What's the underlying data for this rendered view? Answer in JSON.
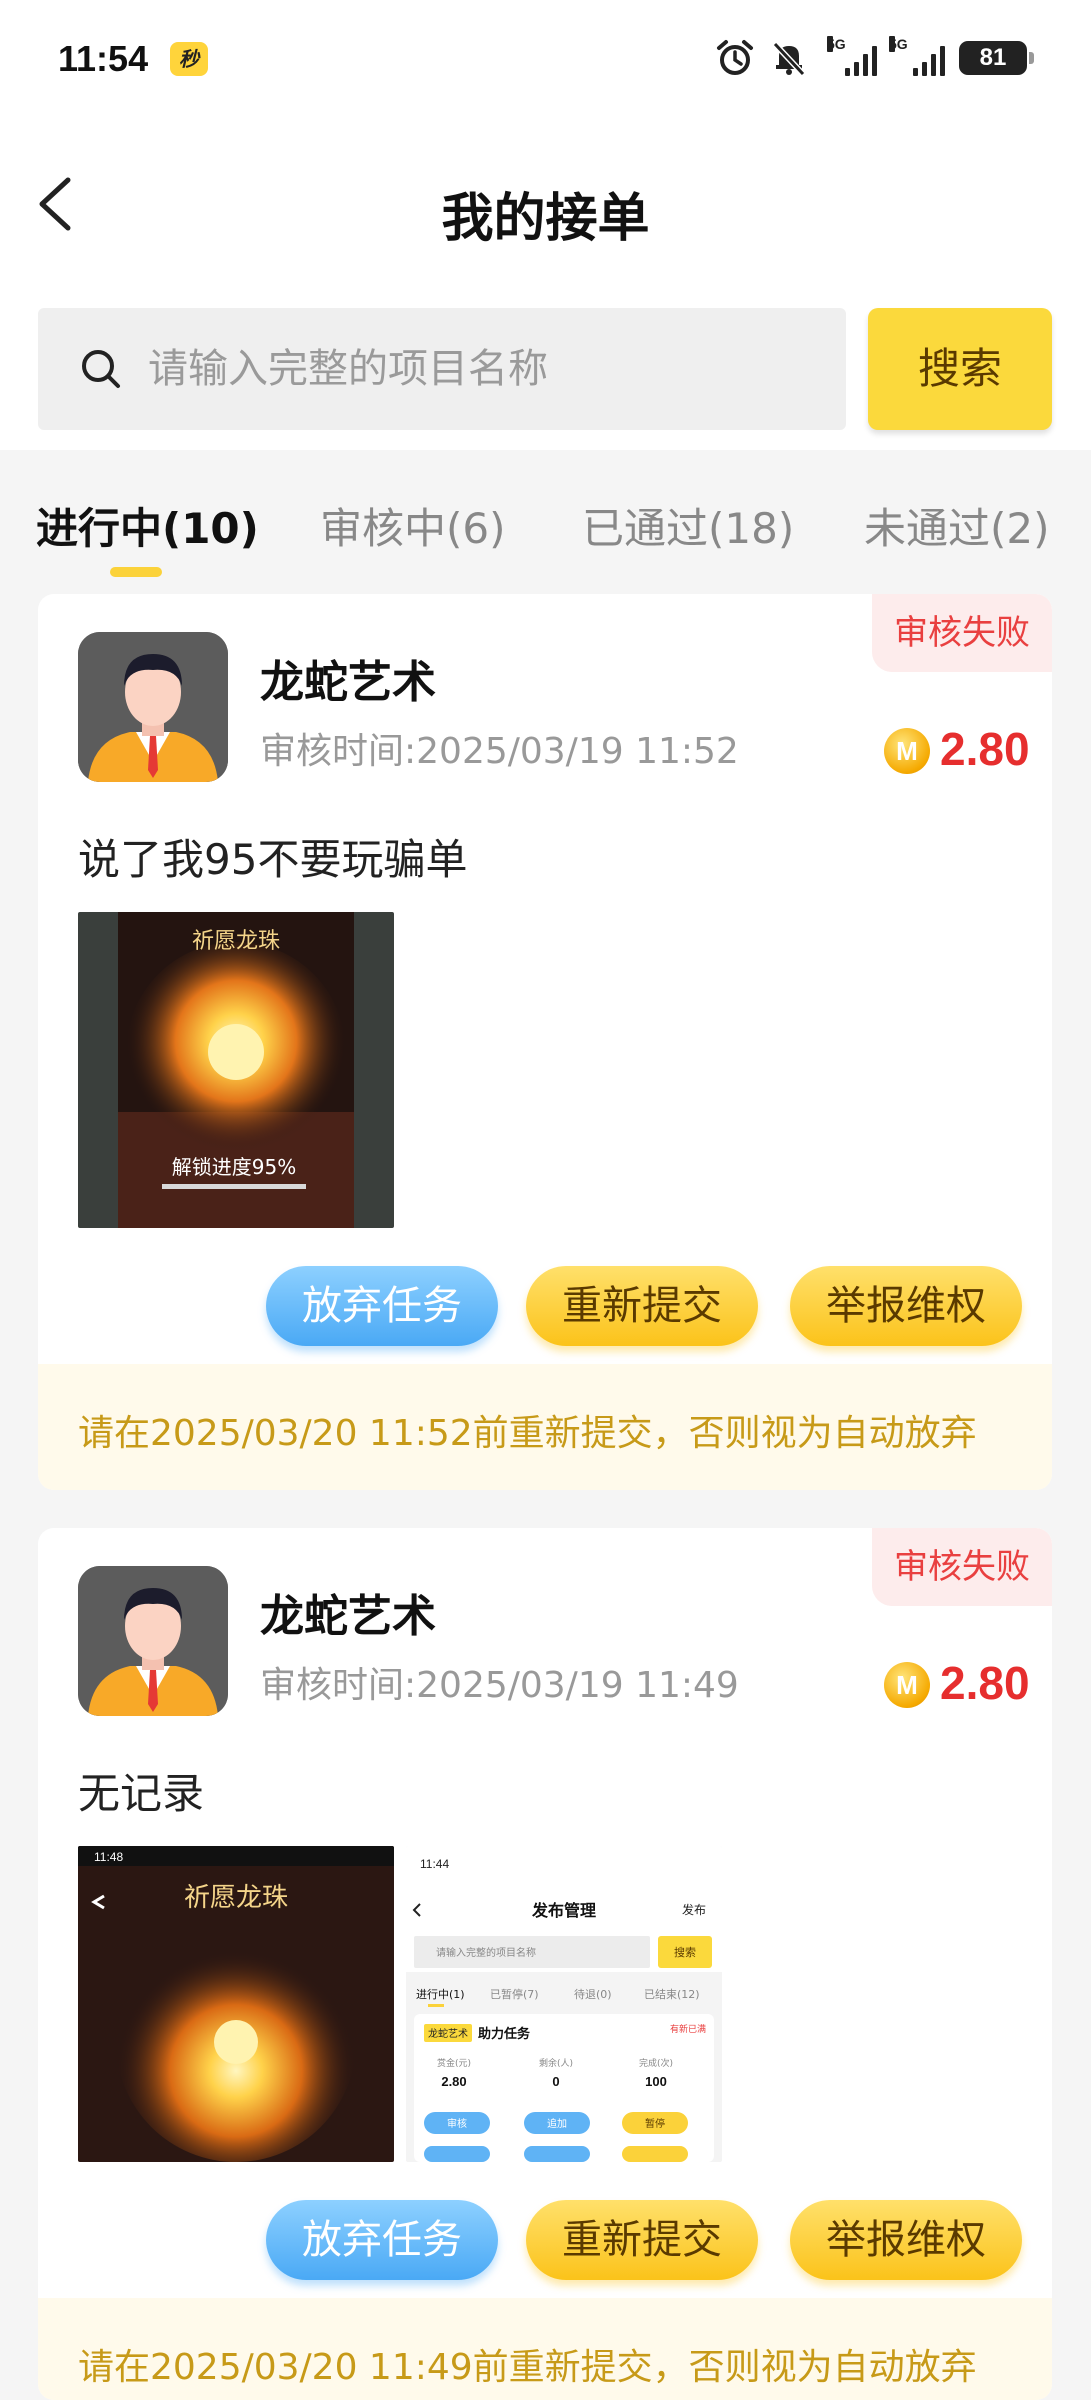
{
  "status_bar": {
    "time": "11:54",
    "app_badge": "秒",
    "net1": "5G",
    "net2": "5G",
    "battery": "81"
  },
  "header": {
    "title": "我的接单"
  },
  "search": {
    "placeholder": "请输入完整的项目名称",
    "button_label": "搜索"
  },
  "tabs": [
    {
      "label": "进行中(10)",
      "active": true
    },
    {
      "label": "审核中(6)",
      "active": false
    },
    {
      "label": "已通过(18)",
      "active": false
    },
    {
      "label": "未通过(2)",
      "active": false
    }
  ],
  "orders": [
    {
      "status": "审核失败",
      "publisher": "龙蛇艺术",
      "review_time": "审核时间:2025/03/19 11:52",
      "coin_label": "M",
      "reward": "2.80",
      "note": "说了我95不要玩骗单",
      "screenshots": [
        {
          "title": "祈愿龙珠",
          "caption": "解锁进度95%"
        }
      ],
      "buttons": {
        "abandon": "放弃任务",
        "resubmit": "重新提交",
        "report": "举报维权"
      },
      "deadline": "请在2025/03/20 11:52前重新提交，否则视为自动放弃"
    },
    {
      "status": "审核失败",
      "publisher": "龙蛇艺术",
      "review_time": "审核时间:2025/03/19 11:49",
      "coin_label": "M",
      "reward": "2.80",
      "note": "无记录",
      "screenshots": [
        {
          "title": "祈愿龙珠",
          "time": "11:48"
        },
        {
          "time": "11:44",
          "title": "发布管理",
          "publish": "发布",
          "search_placeholder": "请输入完整的项目名称",
          "search_button": "搜索",
          "tabs": [
            "进行中(1)",
            "已暂停(7)",
            "待退(0)",
            "已结束(12)"
          ],
          "task_tag": "龙蛇艺术",
          "task_name": "助力任务",
          "task_status": "有新已满",
          "stats": [
            {
              "label": "赏金(元)",
              "value": "2.80"
            },
            {
              "label": "剩余(人)",
              "value": "0"
            },
            {
              "label": "完成(次)",
              "value": "100"
            }
          ],
          "actions": [
            "审核",
            "追加",
            "暂停"
          ]
        }
      ],
      "buttons": {
        "abandon": "放弃任务",
        "resubmit": "重新提交",
        "report": "举报维权"
      },
      "deadline": "请在2025/03/20 11:49前重新提交，否则视为自动放弃"
    }
  ]
}
